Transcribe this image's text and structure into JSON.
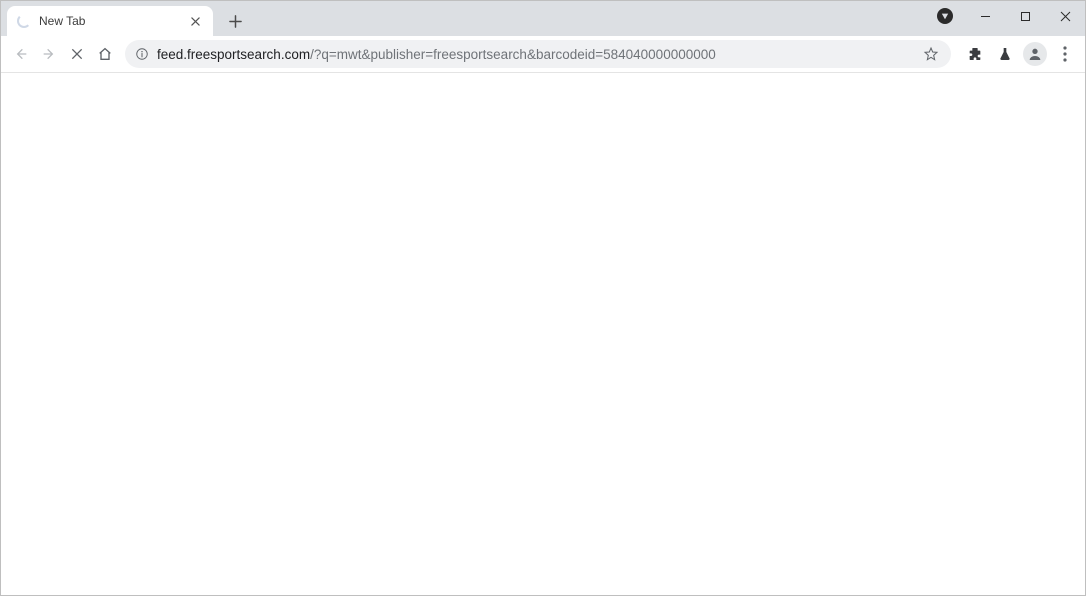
{
  "window": {
    "minimize_tooltip": "Minimize",
    "maximize_tooltip": "Maximize",
    "close_tooltip": "Close"
  },
  "tabs": [
    {
      "title": "New Tab",
      "close_tooltip": "Close tab"
    }
  ],
  "new_tab_tooltip": "New tab",
  "nav": {
    "back_tooltip": "Back",
    "forward_tooltip": "Forward",
    "stop_tooltip": "Stop loading",
    "home_tooltip": "Home"
  },
  "omnibox": {
    "site_info_tooltip": "View site information",
    "url_host": "feed.freesportsearch.com",
    "url_path": "/?q=mwt&publisher=freesportsearch&barcodeid=584040000000000",
    "bookmark_tooltip": "Bookmark this tab"
  },
  "right": {
    "extensions_tooltip": "Extensions",
    "labs_tooltip": "Labs",
    "profile_tooltip": "Profile",
    "menu_tooltip": "Customize and control"
  }
}
